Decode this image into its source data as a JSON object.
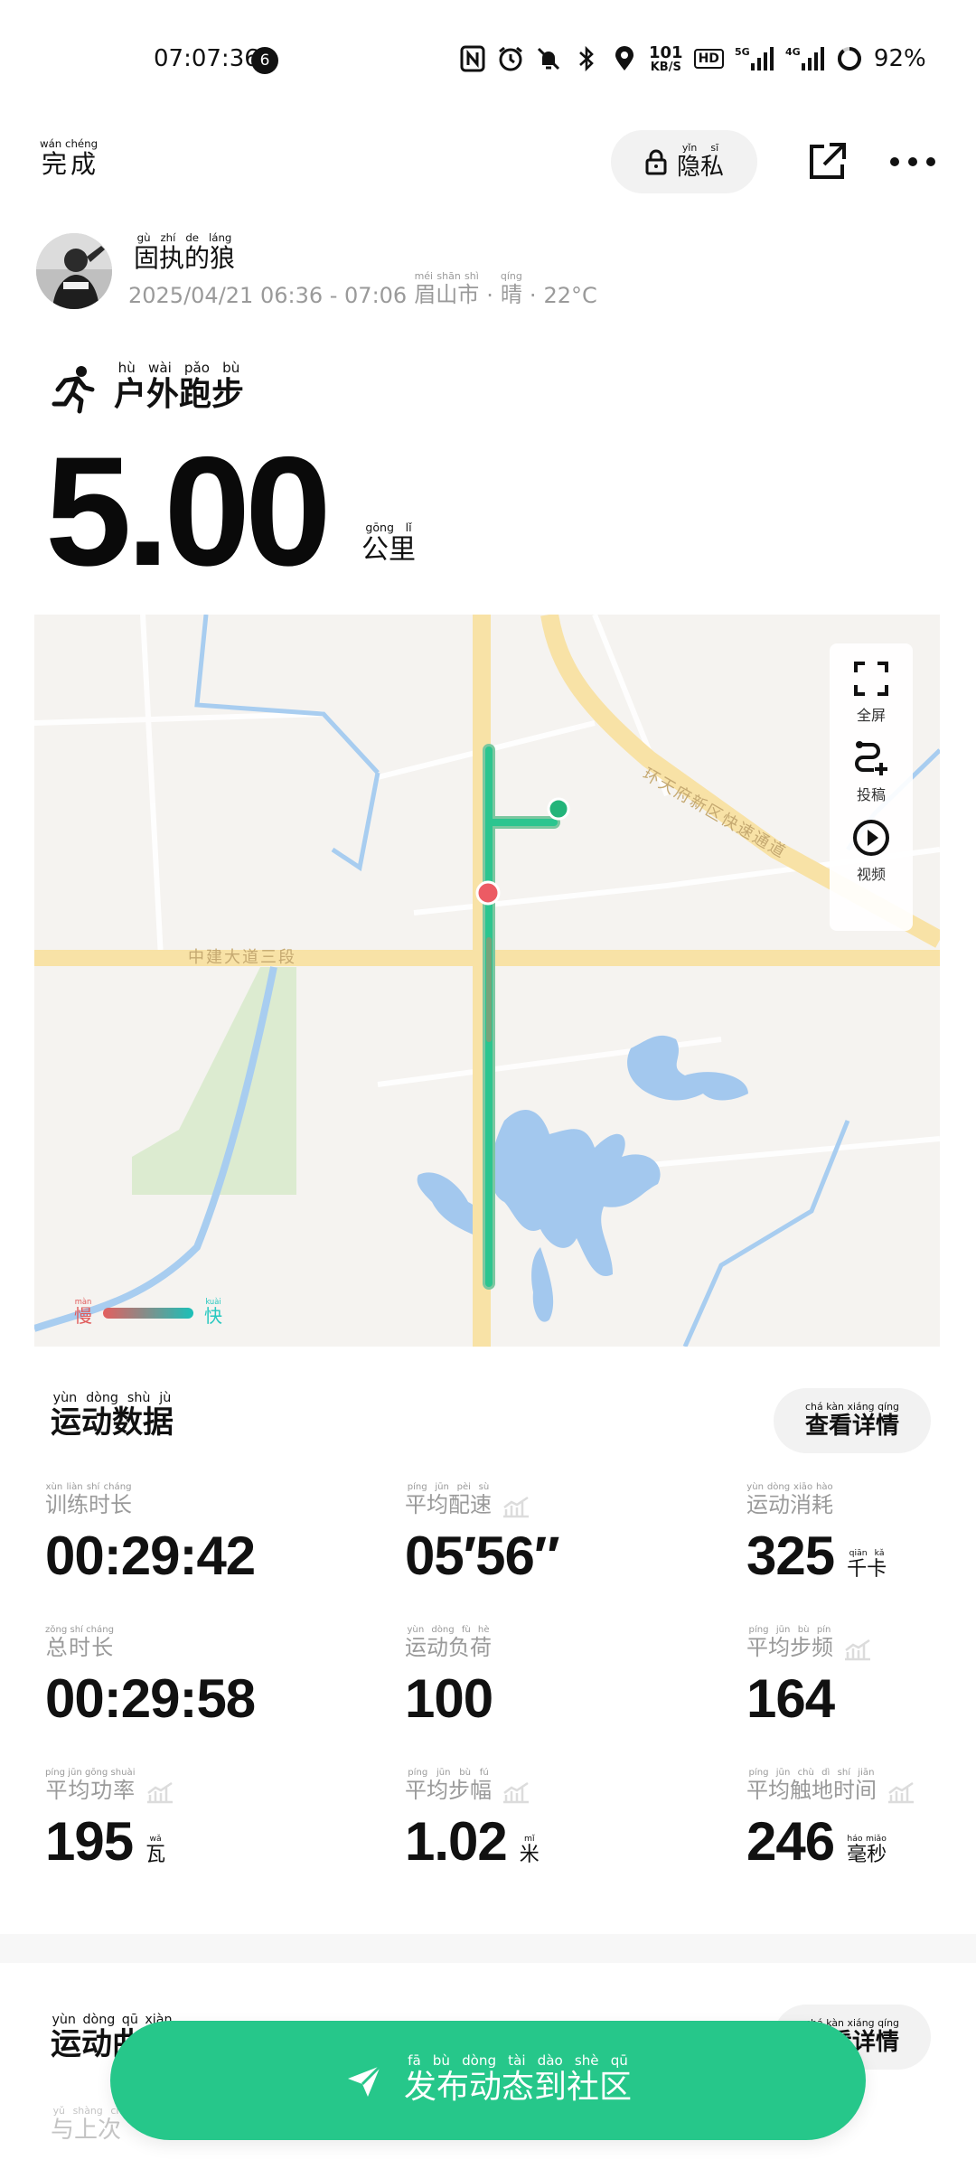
{
  "status_bar": {
    "time": "07:07:36",
    "notification_count": "6",
    "net_speed": "101",
    "net_speed_unit": "KB/S",
    "hd_label": "HD",
    "signal1_label": "5G",
    "signal2_label": "4G",
    "battery": "92%"
  },
  "topbar": {
    "done": "完成",
    "done_pinyin": "wán chéng",
    "privacy": "隐私",
    "privacy_pinyin": "yǐn sī"
  },
  "user": {
    "name": "固执的狼",
    "name_pinyin": "gù zhí de láng",
    "datetime": "2025/04/21 06:36 - 07:06",
    "city": "眉山市",
    "city_pinyin": "méi shān shì",
    "weather": "晴",
    "weather_pinyin": "qíng",
    "temperature": "22°C"
  },
  "activity": {
    "type": "户外跑步",
    "type_pinyin": "hù wài pǎo bù",
    "distance": "5.00",
    "unit": "公里",
    "unit_pinyin": "gōng lǐ"
  },
  "map": {
    "road_label_1": "中建大道三段",
    "road_label_2": "环天府新区快速通道",
    "controls": [
      {
        "label": "全屏",
        "icon": "fullscreen-icon"
      },
      {
        "label": "投稿",
        "icon": "route-add-icon"
      },
      {
        "label": "视频",
        "icon": "play-icon"
      }
    ],
    "legend_slow": "慢",
    "legend_slow_pinyin": "màn",
    "legend_fast": "快",
    "legend_fast_pinyin": "kuài",
    "start_color": "#23b47a",
    "end_color": "#ec5b64"
  },
  "sport_data": {
    "title": "运动数据",
    "title_pinyin": "yùn dòng shù jù",
    "details_button": "查看详情",
    "details_pinyin": "chá kàn xiáng qíng",
    "stats": [
      {
        "label": "训练时长",
        "pinyin": "xùn liàn shí cháng",
        "value": "00:29:42",
        "unit": "",
        "unit_pinyin": ""
      },
      {
        "label": "平均配速",
        "pinyin": "píng jūn pèi sù",
        "value": "05′56″",
        "unit": "",
        "unit_pinyin": ""
      },
      {
        "label": "运动消耗",
        "pinyin": "yùn dòng xiāo hào",
        "value": "325",
        "unit": "千卡",
        "unit_pinyin": "qiān kǎ"
      },
      {
        "label": "总时长",
        "pinyin": "zǒng shí cháng",
        "value": "00:29:58",
        "unit": "",
        "unit_pinyin": ""
      },
      {
        "label": "运动负荷",
        "pinyin": "yùn dòng fù hè",
        "value": "100",
        "unit": "",
        "unit_pinyin": ""
      },
      {
        "label": "平均步频",
        "pinyin": "píng jūn bù pín",
        "value": "164",
        "unit": "",
        "unit_pinyin": ""
      },
      {
        "label": "平均功率",
        "pinyin": "píng jūn gōng shuài",
        "value": "195",
        "unit": "瓦",
        "unit_pinyin": "wǎ"
      },
      {
        "label": "平均步幅",
        "pinyin": "píng jūn bù fú",
        "value": "1.02",
        "unit": "米",
        "unit_pinyin": "mǐ"
      },
      {
        "label": "平均触地时间",
        "pinyin": "píng jūn chù dì shí jiān",
        "value": "246",
        "unit": "毫秒",
        "unit_pinyin": "háo miǎo"
      }
    ]
  },
  "section2": {
    "title": "运动曲线",
    "title_pinyin": "yùn dòng qū xiàn",
    "details_button": "查看详情",
    "details_pinyin": "chá kàn xiáng qíng",
    "faded_label": "与上次",
    "faded_pinyin": "yǔ shàng cì"
  },
  "publish": {
    "label": "发布动态到社区",
    "pinyin": "fā bù dòng tài dào shè qū"
  }
}
